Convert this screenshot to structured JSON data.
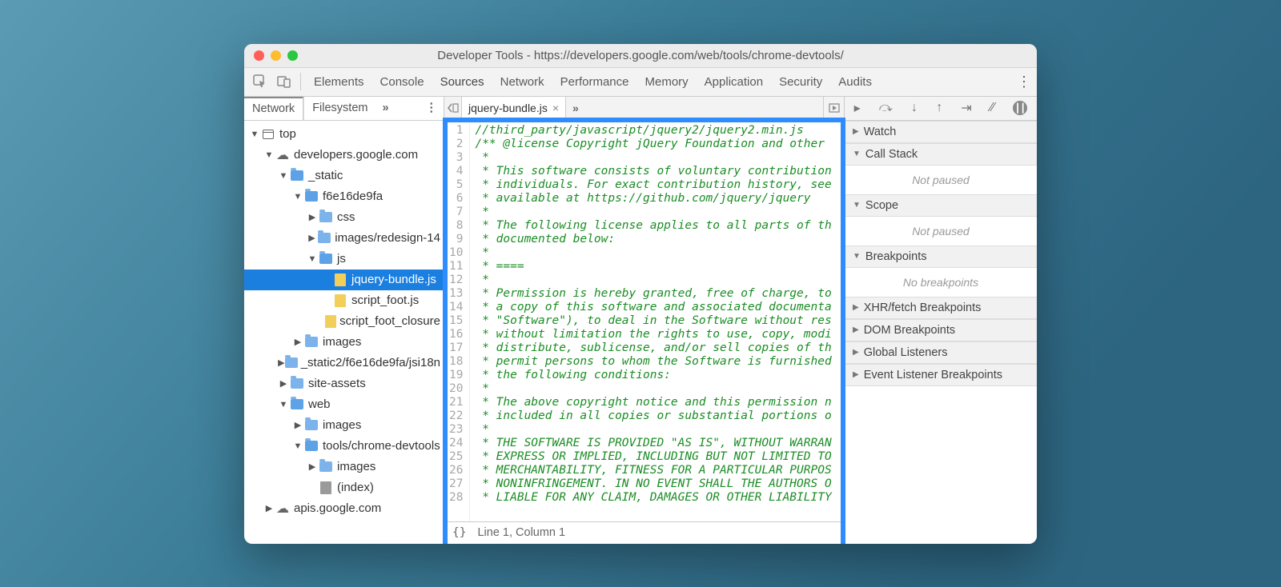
{
  "window_title": "Developer Tools - https://developers.google.com/web/tools/chrome-devtools/",
  "toolbar_tabs": [
    "Elements",
    "Console",
    "Sources",
    "Network",
    "Performance",
    "Memory",
    "Application",
    "Security",
    "Audits"
  ],
  "active_toolbar_tab": "Sources",
  "left_subtabs": [
    "Network",
    "Filesystem"
  ],
  "active_left_subtab": "Network",
  "tree": [
    {
      "depth": 0,
      "expand": "▼",
      "icon": "window",
      "label": "top"
    },
    {
      "depth": 1,
      "expand": "▼",
      "icon": "cloud",
      "label": "developers.google.com"
    },
    {
      "depth": 2,
      "expand": "▼",
      "icon": "folder-o",
      "label": "_static"
    },
    {
      "depth": 3,
      "expand": "▼",
      "icon": "folder-o",
      "label": "f6e16de9fa"
    },
    {
      "depth": 4,
      "expand": "▶",
      "icon": "folder",
      "label": "css"
    },
    {
      "depth": 4,
      "expand": "▶",
      "icon": "folder",
      "label": "images/redesign-14"
    },
    {
      "depth": 4,
      "expand": "▼",
      "icon": "folder-o",
      "label": "js"
    },
    {
      "depth": 5,
      "expand": "",
      "icon": "file-js",
      "label": "jquery-bundle.js",
      "selected": true
    },
    {
      "depth": 5,
      "expand": "",
      "icon": "file-js",
      "label": "script_foot.js"
    },
    {
      "depth": 5,
      "expand": "",
      "icon": "file-js",
      "label": "script_foot_closure"
    },
    {
      "depth": 3,
      "expand": "▶",
      "icon": "folder",
      "label": "images"
    },
    {
      "depth": 2,
      "expand": "▶",
      "icon": "folder",
      "label": "_static2/f6e16de9fa/jsi18n"
    },
    {
      "depth": 2,
      "expand": "▶",
      "icon": "folder",
      "label": "site-assets"
    },
    {
      "depth": 2,
      "expand": "▼",
      "icon": "folder-o",
      "label": "web"
    },
    {
      "depth": 3,
      "expand": "▶",
      "icon": "folder",
      "label": "images"
    },
    {
      "depth": 3,
      "expand": "▼",
      "icon": "folder-o",
      "label": "tools/chrome-devtools"
    },
    {
      "depth": 4,
      "expand": "▶",
      "icon": "folder",
      "label": "images"
    },
    {
      "depth": 4,
      "expand": "",
      "icon": "file-plain",
      "label": "(index)"
    },
    {
      "depth": 1,
      "expand": "▶",
      "icon": "cloud",
      "label": "apis.google.com"
    }
  ],
  "editor": {
    "filename": "jquery-bundle.js",
    "status": "Line 1, Column 1",
    "lines": [
      "//third_party/javascript/jquery2/jquery2.min.js",
      "/** @license Copyright jQuery Foundation and other",
      " *",
      " * This software consists of voluntary contribution",
      " * individuals. For exact contribution history, see",
      " * available at https://github.com/jquery/jquery",
      " *",
      " * The following license applies to all parts of th",
      " * documented below:",
      " *",
      " * ====",
      " *",
      " * Permission is hereby granted, free of charge, to",
      " * a copy of this software and associated documenta",
      " * \"Software\"), to deal in the Software without res",
      " * without limitation the rights to use, copy, modi",
      " * distribute, sublicense, and/or sell copies of th",
      " * permit persons to whom the Software is furnished",
      " * the following conditions:",
      " *",
      " * The above copyright notice and this permission n",
      " * included in all copies or substantial portions o",
      " *",
      " * THE SOFTWARE IS PROVIDED \"AS IS\", WITHOUT WARRAN",
      " * EXPRESS OR IMPLIED, INCLUDING BUT NOT LIMITED TO",
      " * MERCHANTABILITY, FITNESS FOR A PARTICULAR PURPOS",
      " * NONINFRINGEMENT. IN NO EVENT SHALL THE AUTHORS O",
      " * LIABLE FOR ANY CLAIM, DAMAGES OR OTHER LIABILITY"
    ]
  },
  "right": {
    "watch": "Watch",
    "callstack": "Call Stack",
    "callstack_body": "Not paused",
    "scope": "Scope",
    "scope_body": "Not paused",
    "breakpoints": "Breakpoints",
    "breakpoints_body": "No breakpoints",
    "xhr": "XHR/fetch Breakpoints",
    "dom": "DOM Breakpoints",
    "global": "Global Listeners",
    "events": "Event Listener Breakpoints"
  }
}
